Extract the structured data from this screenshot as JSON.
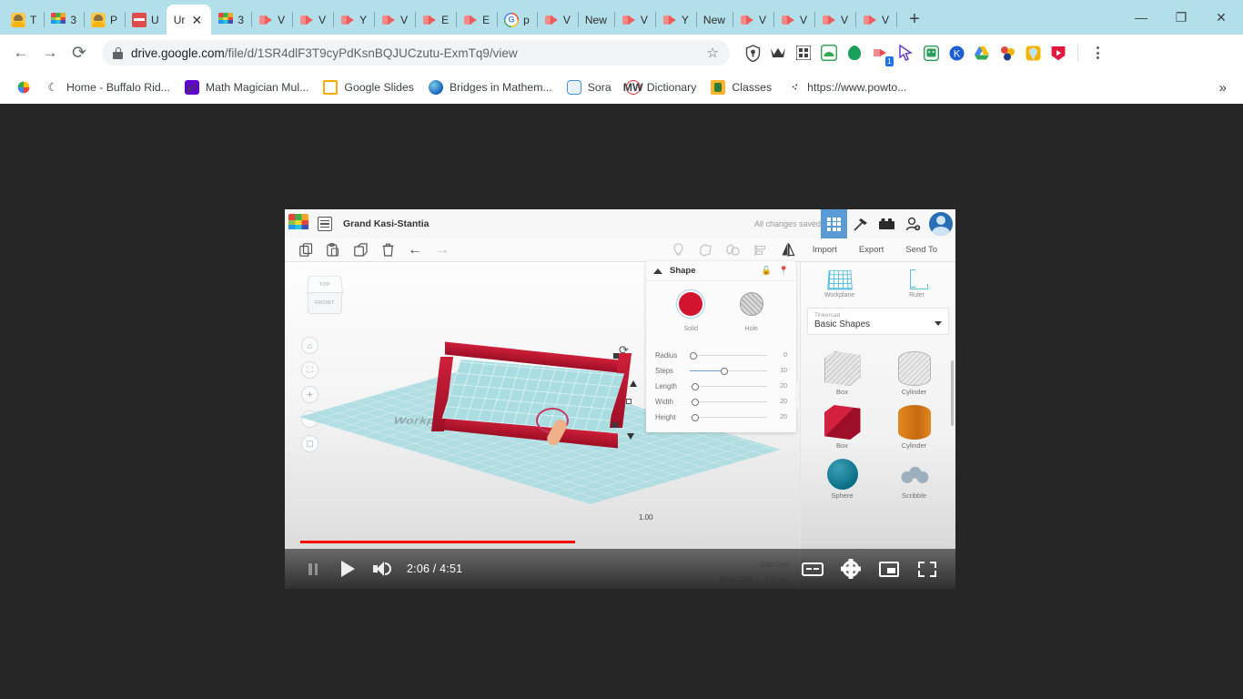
{
  "browser": {
    "tabs": [
      {
        "label": "T",
        "icon": "person-icon",
        "active": false
      },
      {
        "label": "3",
        "icon": "tinkercad-icon",
        "active": false
      },
      {
        "label": "P",
        "icon": "person-icon",
        "active": false
      },
      {
        "label": "U",
        "icon": "red-icon",
        "active": false
      },
      {
        "label": "Ur",
        "icon": "blank-icon",
        "active": true
      },
      {
        "label": "3",
        "icon": "tinkercad-icon",
        "active": false
      },
      {
        "label": "V",
        "icon": "vimeo-icon",
        "active": false
      },
      {
        "label": "V",
        "icon": "vimeo-icon",
        "active": false
      },
      {
        "label": "Y",
        "icon": "vimeo-icon",
        "active": false
      },
      {
        "label": "V",
        "icon": "vimeo-icon",
        "active": false
      },
      {
        "label": "E",
        "icon": "vimeo-icon",
        "active": false
      },
      {
        "label": "E",
        "icon": "vimeo-icon",
        "active": false
      },
      {
        "label": "p",
        "icon": "google-icon",
        "active": false
      },
      {
        "label": "V",
        "icon": "vimeo-icon",
        "active": false
      },
      {
        "label": "New",
        "icon": "blank-icon",
        "active": false
      },
      {
        "label": "V",
        "icon": "vimeo-icon",
        "active": false
      },
      {
        "label": "Y",
        "icon": "vimeo-icon",
        "active": false
      },
      {
        "label": "New",
        "icon": "blank-icon",
        "active": false
      },
      {
        "label": "V",
        "icon": "vimeo-icon",
        "active": false
      },
      {
        "label": "V",
        "icon": "vimeo-icon",
        "active": false
      },
      {
        "label": "V",
        "icon": "vimeo-icon",
        "active": false
      },
      {
        "label": "V",
        "icon": "vimeo-icon",
        "active": false
      }
    ],
    "new_tab_label": "+",
    "window_controls": {
      "minimize": "—",
      "maximize": "❐",
      "close": "✕"
    },
    "nav": {
      "back": "←",
      "forward": "→",
      "reload": "⟳"
    },
    "omnibox": {
      "domain": "drive.google.com",
      "path": "/file/d/1SR4dlF3T9cyPdKsnBQJUCzutu-ExmTq9/view",
      "full_url": "drive.google.com/file/d/1SR4dlF3T9cyPdKsnBQJUCzutu-ExmTq9/view",
      "star": "☆",
      "lock": "secure-lock-icon"
    },
    "extensions": [
      {
        "name": "shield-extension-icon",
        "badge": ""
      },
      {
        "name": "crown-extension-icon",
        "badge": ""
      },
      {
        "name": "grid-extension-icon",
        "badge": ""
      },
      {
        "name": "green-arch-extension-icon",
        "badge": ""
      },
      {
        "name": "green-drop-extension-icon",
        "badge": ""
      },
      {
        "name": "screencast-extension-icon",
        "badge": "1"
      },
      {
        "name": "cursor-extension-icon",
        "badge": ""
      },
      {
        "name": "classroom-extension-icon",
        "badge": ""
      },
      {
        "name": "kami-extension-icon",
        "badge": ""
      },
      {
        "name": "drive-extension-icon",
        "badge": ""
      },
      {
        "name": "molecule-extension-icon",
        "badge": ""
      },
      {
        "name": "pin-extension-icon",
        "badge": ""
      },
      {
        "name": "video-extension-icon",
        "badge": ""
      }
    ],
    "bookmarks": [
      {
        "label": "",
        "icon": "photos-icon"
      },
      {
        "label": "Home - Buffalo Rid...",
        "icon": "moon-icon"
      },
      {
        "label": "Math Magician Mul...",
        "icon": "yahoo-icon"
      },
      {
        "label": "Google Slides",
        "icon": "slides-icon"
      },
      {
        "label": "Bridges in Mathem...",
        "icon": "globe-icon"
      },
      {
        "label": "Sora",
        "icon": "sora-icon"
      },
      {
        "label": "Dictionary",
        "icon": "merriam-webster-icon"
      },
      {
        "label": "Classes",
        "icon": "classroom-icon"
      },
      {
        "label": "https://www.powto...",
        "icon": "powtoon-icon"
      }
    ],
    "bookmark_overflow": "»"
  },
  "player": {
    "current_time": "2:06",
    "duration": "4:51",
    "time_display": "2:06 / 4:51",
    "progress_percent": 43,
    "controls": {
      "pause": "pause-button",
      "play": "play-button",
      "volume": "volume-button",
      "captions": "captions-button",
      "settings": "settings-button",
      "miniplayer": "miniplayer-button",
      "fullscreen": "fullscreen-button"
    }
  },
  "tinkercad": {
    "project_title": "Grand Kasi-Stantia",
    "save_status": "All changes saved",
    "topbar_buttons": [
      "design-grid-button",
      "hammer-codeblocks-button",
      "bricks-button",
      "invite-person-button",
      "account-avatar"
    ],
    "toolbar_left": [
      "copy-button",
      "paste-button",
      "duplicate-button",
      "delete-button",
      "undo-button",
      "redo-button"
    ],
    "toolbar_right_icons": [
      "lightbulb-button",
      "group-button",
      "ungroup-button",
      "align-button",
      "mirror-button"
    ],
    "toolbar_right_text": [
      "Import",
      "Export",
      "Send To"
    ],
    "canvas": {
      "viewcube": {
        "top": "TOP",
        "front": "FRONT"
      },
      "nav_buttons": [
        "home-view-button",
        "fit-all-button",
        "zoom-in-button",
        "zoom-out-button",
        "ortho-perspective-button"
      ],
      "workplane_label": "Workplane",
      "dimension_label": "1.00",
      "edit_grid": "Edit Grid",
      "snap_grid_label": "Snap Grid",
      "snap_grid_value": "1.0 mm"
    },
    "shape_panel": {
      "title": "Shape",
      "lock_icon": "unlock-icon",
      "pin_icon": "pin-icon",
      "swatches": [
        {
          "label": "Solid",
          "color": "#d2142f",
          "selected": true
        },
        {
          "label": "Hole",
          "color": "#c4c4c4",
          "selected": false
        }
      ],
      "properties": [
        {
          "label": "Radius",
          "value": "0",
          "fill_percent": 4
        },
        {
          "label": "Steps",
          "value": "10",
          "fill_percent": 42
        },
        {
          "label": "Length",
          "value": "20",
          "fill_percent": 5
        },
        {
          "label": "Width",
          "value": "20",
          "fill_percent": 5
        },
        {
          "label": "Height",
          "value": "20",
          "fill_percent": 5
        }
      ],
      "collapse_icon": "›"
    },
    "sidebar": {
      "tools": [
        {
          "label": "Workplane",
          "icon": "workplane-icon"
        },
        {
          "label": "Ruler",
          "icon": "ruler-icon"
        }
      ],
      "library_source": "Tinkercad",
      "library_name": "Basic Shapes",
      "shapes": [
        {
          "label": "Box",
          "style": "hole-gray-box"
        },
        {
          "label": "Cylinder",
          "style": "hole-gray-cylinder"
        },
        {
          "label": "Box",
          "style": "solid-red-box"
        },
        {
          "label": "Cylinder",
          "style": "solid-orange-cylinder"
        },
        {
          "label": "Sphere",
          "style": "solid-teal-sphere"
        },
        {
          "label": "Scribble",
          "style": "scribble-shape"
        }
      ]
    }
  }
}
